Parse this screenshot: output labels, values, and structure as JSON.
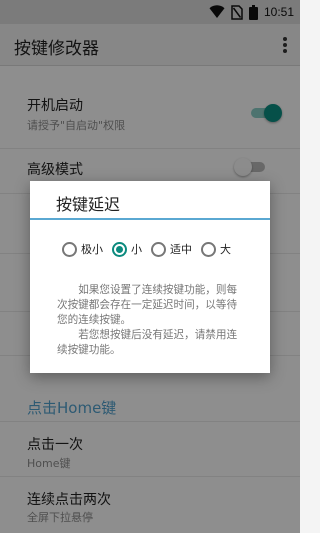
{
  "status_bar": {
    "time": "10:51"
  },
  "app_bar": {
    "title": "按键修改器"
  },
  "settings": [
    {
      "title": "开机启动",
      "subtitle": "请授予\"自启动\"权限",
      "toggle_on": true
    },
    {
      "title": "高级模式",
      "toggle_on": false
    }
  ],
  "section": {
    "header": "点击Home键"
  },
  "home_items": [
    {
      "title": "点击一次",
      "subtitle": "Home键"
    },
    {
      "title": "连续点击两次",
      "subtitle": "全屏下拉悬停"
    }
  ],
  "dialog": {
    "title": "按键延迟",
    "options": [
      {
        "label": "极小",
        "checked": false
      },
      {
        "label": "小",
        "checked": true
      },
      {
        "label": "适中",
        "checked": false
      },
      {
        "label": "大",
        "checked": false
      }
    ],
    "paragraphs": [
      "如果您设置了连续按键功能，则每次按键都会存在一定延迟时间，以等待您的连续按键。",
      "若您想按键后没有延迟，请禁用连续按键功能。"
    ]
  },
  "colors": {
    "accent": "#0b8a7e",
    "section_header": "#4f9cc7",
    "dialog_divider": "#5aa8d2"
  }
}
